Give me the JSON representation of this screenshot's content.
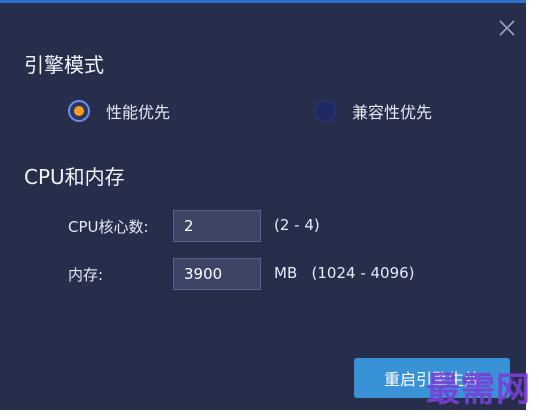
{
  "engine": {
    "title": "引擎模式",
    "options": [
      {
        "label": "性能优先",
        "selected": true
      },
      {
        "label": "兼容性优先",
        "selected": false
      }
    ]
  },
  "cpu_memory": {
    "title": "CPU和内存",
    "cpu": {
      "label": "CPU核心数:",
      "value": "2",
      "hint": "(2 - 4)"
    },
    "memory": {
      "label": "内存:",
      "value": "3900",
      "hint": "MB   (1024 - 4096)"
    }
  },
  "actions": {
    "restart_label": "重启引擎生效"
  },
  "watermark": "最需网",
  "icons": {
    "close": "close-icon"
  },
  "colors": {
    "background": "#272e4c",
    "accent": "#3a92d6",
    "radio_dot": "#f5a025",
    "top_bar": "#2f6fd0"
  }
}
